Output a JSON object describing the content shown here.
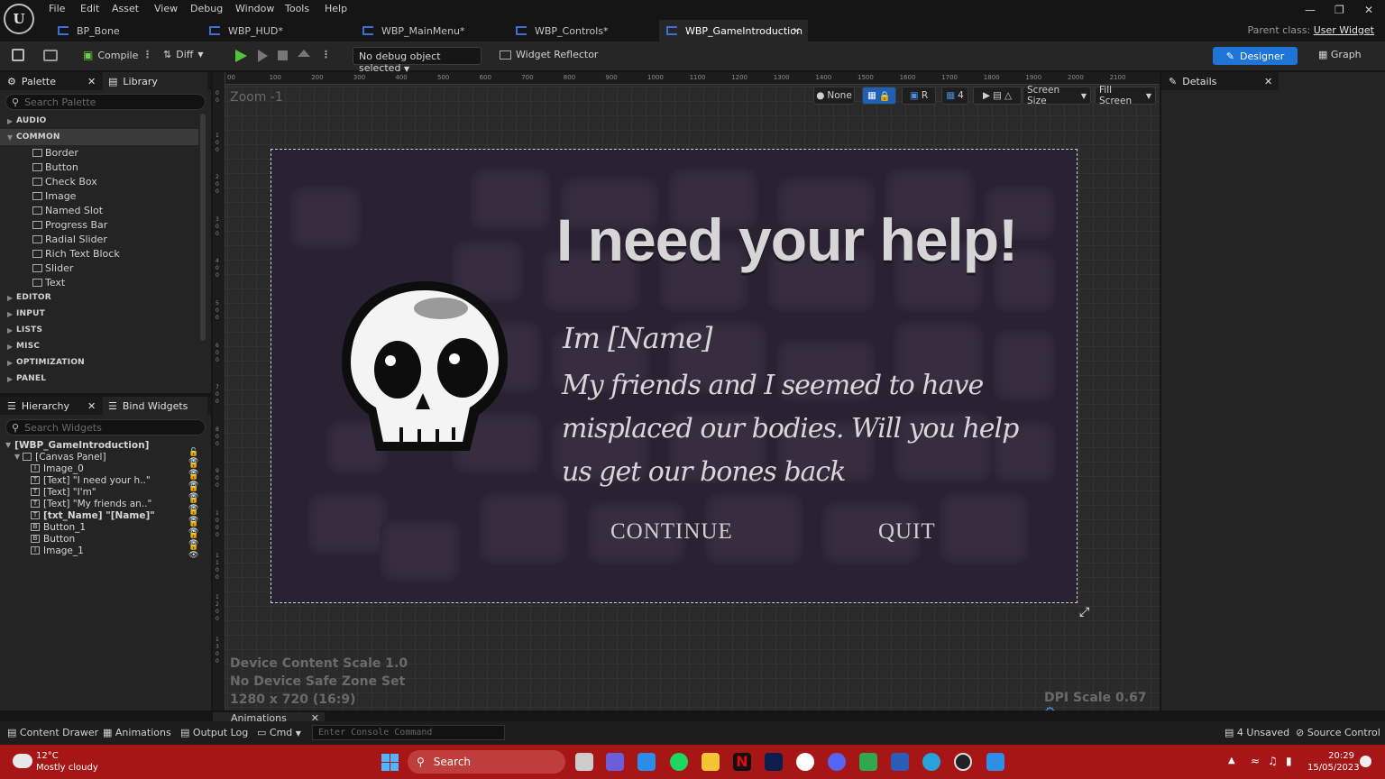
{
  "menu": [
    "File",
    "Edit",
    "Asset",
    "View",
    "Debug",
    "Window",
    "Tools",
    "Help"
  ],
  "tabs": [
    {
      "label": "BP_Bone"
    },
    {
      "label": "WBP_HUD*"
    },
    {
      "label": "WBP_MainMenu*"
    },
    {
      "label": "WBP_Controls*"
    },
    {
      "label": "WBP_GameIntroduction",
      "active": true
    }
  ],
  "parent_class": {
    "label": "Parent class:",
    "value": "User Widget"
  },
  "toolbar": {
    "compile": "Compile",
    "diff": "Diff",
    "debug_select": "No debug object selected",
    "widget_reflector": "Widget Reflector",
    "designer": "Designer",
    "graph": "Graph"
  },
  "palette": {
    "title": "Palette",
    "library": "Library",
    "search_placeholder": "Search Palette",
    "categories_top": [
      "AUDIO"
    ],
    "common_label": "COMMON",
    "common_items": [
      {
        "label": "Border",
        "icon": "border-icon"
      },
      {
        "label": "Button",
        "icon": "button-icon"
      },
      {
        "label": "Check Box",
        "icon": "checkbox-icon"
      },
      {
        "label": "Image",
        "icon": "image-icon"
      },
      {
        "label": "Named Slot",
        "icon": "named-slot-icon"
      },
      {
        "label": "Progress Bar",
        "icon": "progress-bar-icon"
      },
      {
        "label": "Radial Slider",
        "icon": "radial-slider-icon"
      },
      {
        "label": "Rich Text Block",
        "icon": "rich-text-icon"
      },
      {
        "label": "Slider",
        "icon": "slider-icon"
      },
      {
        "label": "Text",
        "icon": "text-icon"
      }
    ],
    "categories_bottom": [
      "EDITOR",
      "INPUT",
      "LISTS",
      "MISC",
      "OPTIMIZATION",
      "PANEL"
    ]
  },
  "hierarchy": {
    "title": "Hierarchy",
    "bind_widgets": "Bind Widgets",
    "search_placeholder": "Search Widgets",
    "root": "[WBP_GameIntroduction]",
    "canvas": "[Canvas Panel]",
    "items": [
      {
        "label": "Image_0",
        "icon": "I"
      },
      {
        "label": "[Text] \"I need your h..\"",
        "icon": "T"
      },
      {
        "label": "[Text] \"I'm\"",
        "icon": "T"
      },
      {
        "label": "[Text] \"My friends an..\"",
        "icon": "T"
      },
      {
        "label": "[txt_Name] \"[Name]\"",
        "icon": "T",
        "bold": true
      },
      {
        "label": "Button_1",
        "icon": "B"
      },
      {
        "label": "Button",
        "icon": "B"
      },
      {
        "label": "Image_1",
        "icon": "I"
      }
    ]
  },
  "viewport": {
    "zoom": "Zoom -1",
    "ruler_marks": [
      "00",
      "100",
      "200",
      "300",
      "400",
      "500",
      "600",
      "700",
      "800",
      "900",
      "1000",
      "1100",
      "1200",
      "1300",
      "1400",
      "1500",
      "1600",
      "1700",
      "1800",
      "1900",
      "2000",
      "2100"
    ],
    "tools": {
      "none": "None",
      "r": "R",
      "grid_count": "4",
      "screen_size": "Screen Size",
      "fill_screen": "Fill Screen"
    },
    "device_scale": "Device Content Scale 1.0",
    "safe_zone": "No Device Safe Zone Set",
    "resolution": "1280 x 720 (16:9)",
    "dpi": "DPI Scale 0.67"
  },
  "widget": {
    "title": "I need your help!",
    "greeting": "Im [Name]",
    "body": "My friends and I seemed to have misplaced our bodies. Will you help us get our bones back",
    "continue": "CONTINUE",
    "quit": "QUIT"
  },
  "details": {
    "title": "Details"
  },
  "animations_tab": "Animations",
  "bottom": {
    "content_drawer": "Content Drawer",
    "animations": "Animations",
    "output_log": "Output Log",
    "cmd": "Cmd",
    "console_placeholder": "Enter Console Command",
    "unsaved": "4 Unsaved",
    "source_control": "Source Control"
  },
  "taskbar": {
    "temp": "12°C",
    "weather": "Mostly cloudy",
    "search": "Search",
    "time": "20:29",
    "date": "15/05/2023"
  }
}
